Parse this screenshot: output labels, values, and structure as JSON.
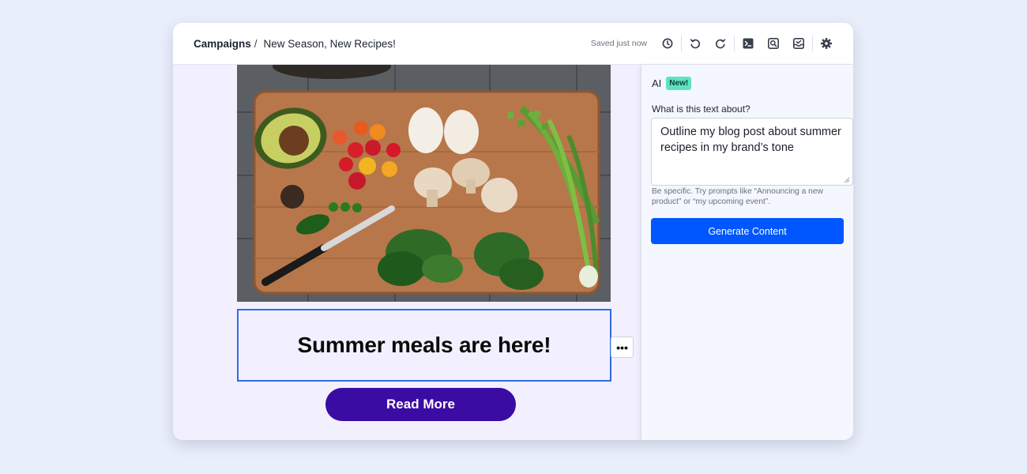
{
  "breadcrumb": {
    "root": "Campaigns",
    "separator": "/",
    "current": "New Season, New Recipes!"
  },
  "toolbar": {
    "saved_status": "Saved just now",
    "icons": [
      "history-icon",
      "undo-icon",
      "redo-icon",
      "code-icon",
      "preview-icon",
      "inbox-icon",
      "settings-icon"
    ]
  },
  "email": {
    "image_alt": "Cutting board with avocado, tomatoes, eggs, mushrooms, peppers, knife, spinach and green onions",
    "headline": "Summer meals are here!",
    "more_button": "•••",
    "cta_label": "Read More"
  },
  "ai_panel": {
    "title": "AI",
    "badge": "New!",
    "question": "What is this text about?",
    "prompt_value": "Outline my blog post about summer recipes in my brand’s tone",
    "hint": "Be specific. Try prompts like “Announcing a new product” or “my upcoming event”.",
    "button_label": "Generate Content"
  },
  "colors": {
    "accent": "#0057ff",
    "cta": "#3a0ca3",
    "badge": "#5de3c0",
    "selection": "#2f6ae6"
  }
}
